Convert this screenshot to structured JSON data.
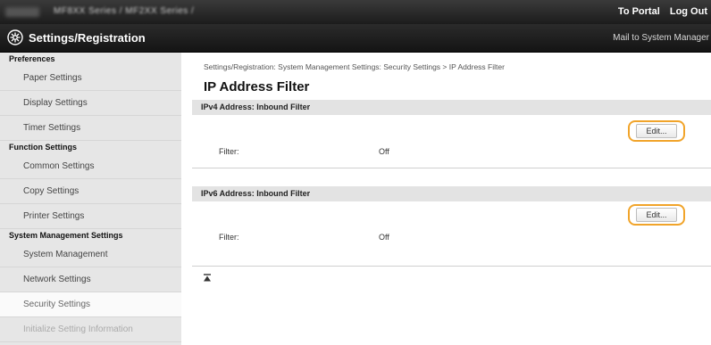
{
  "topbar": {
    "model_text": "MF8XX Series / MF2XX Series /",
    "to_portal": "To Portal",
    "log_out": "Log Out"
  },
  "header": {
    "title": "Settings/Registration",
    "mail": "Mail to System Manager"
  },
  "sidebar": {
    "preferences": "Preferences",
    "paper_settings": "Paper Settings",
    "display_settings": "Display Settings",
    "timer_settings": "Timer Settings",
    "function_settings": "Function Settings",
    "common_settings": "Common Settings",
    "copy_settings": "Copy Settings",
    "printer_settings": "Printer Settings",
    "system_management_settings": "System Management Settings",
    "system_management": "System Management",
    "network_settings": "Network Settings",
    "security_settings": "Security Settings",
    "initialize": "Initialize Setting Information"
  },
  "main": {
    "breadcrumb": "Settings/Registration: System Management Settings: Security Settings > IP Address Filter",
    "title": "IP Address Filter",
    "ipv4": {
      "heading": "IPv4 Address: Inbound Filter",
      "edit": "Edit...",
      "filter_label": "Filter:",
      "filter_value": "Off"
    },
    "ipv6": {
      "heading": "IPv6 Address: Inbound Filter",
      "edit": "Edit...",
      "filter_label": "Filter:",
      "filter_value": "Off"
    },
    "to_top_icon": "to-top-icon"
  },
  "colors": {
    "highlight": "#f1a42a",
    "header_bg": "#1c1c1c",
    "sidebar_bg": "#e6e6e6"
  }
}
